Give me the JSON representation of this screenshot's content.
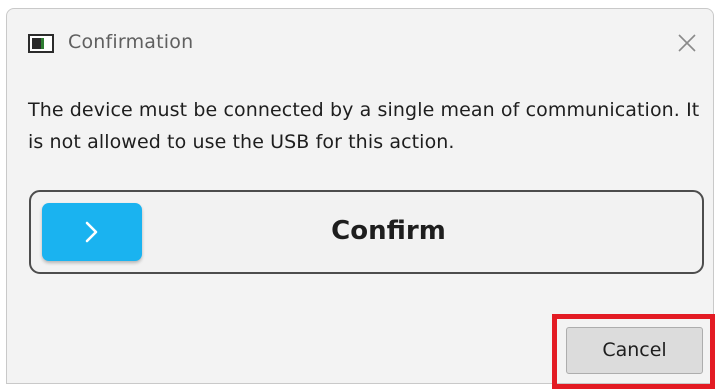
{
  "window": {
    "title": "Confirmation",
    "app_icon": "app-window-icon",
    "close_icon": "close-icon"
  },
  "message": {
    "text": "The device must be connected by a single mean of communication. It is not allowed to use the USB for this action."
  },
  "confirm": {
    "label": "Confirm",
    "icon": "chevron-right-icon",
    "icon_bg_color": "#1ab3f0"
  },
  "cancel": {
    "label": "Cancel",
    "highlight_color": "#e31b23"
  }
}
